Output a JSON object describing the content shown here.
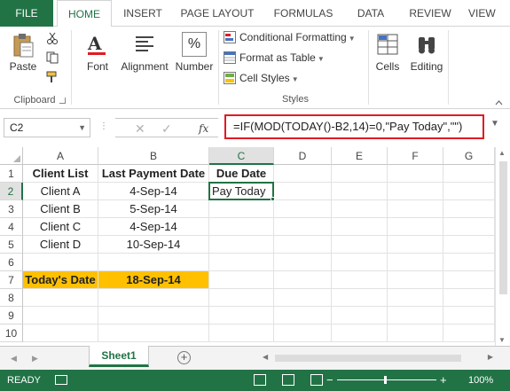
{
  "ribbon_tabs": {
    "file": "FILE",
    "home": "HOME",
    "insert": "INSERT",
    "page_layout": "PAGE LAYOUT",
    "formulas": "FORMULAS",
    "data": "DATA",
    "review": "REVIEW",
    "view": "VIEW"
  },
  "clipboard": {
    "paste_label": "Paste",
    "group_label": "Clipboard"
  },
  "font_group": {
    "label": "Font"
  },
  "alignment_group": {
    "label": "Alignment"
  },
  "number_group": {
    "label": "Number",
    "icon_text": "%"
  },
  "styles": {
    "conditional_formatting": "Conditional Formatting",
    "format_as_table": "Format as Table",
    "cell_styles": "Cell Styles",
    "group_label": "Styles"
  },
  "cells_group": {
    "label": "Cells"
  },
  "editing_group": {
    "label": "Editing"
  },
  "formula_bar": {
    "name_box": "C2",
    "formula": "=IF(MOD(TODAY()-B2,14)=0,\"Pay Today\",\"\")",
    "cancel_glyph": "✕",
    "enter_glyph": "✓",
    "fx_label": "fx"
  },
  "columns": [
    "A",
    "B",
    "C",
    "D",
    "E",
    "F",
    "G"
  ],
  "rows": [
    "1",
    "2",
    "3",
    "4",
    "5",
    "6",
    "7",
    "8",
    "9",
    "10"
  ],
  "cells": {
    "A1": "Client List",
    "B1": "Last Payment Date",
    "C1": "Due Date",
    "A2": "Client A",
    "B2": "4-Sep-14",
    "C2": "Pay Today",
    "A3": "Client B",
    "B3": "5-Sep-14",
    "A4": "Client C",
    "B4": "4-Sep-14",
    "A5": "Client D",
    "B5": "10-Sep-14",
    "A7": "Today's Date",
    "B7": "18-Sep-14"
  },
  "colors": {
    "excel_green": "#217346",
    "highlight": "#ffc000",
    "formula_outline": "#e01b24"
  },
  "sheet_tabs": {
    "active": "Sheet1",
    "add_glyph": "+"
  },
  "status_bar": {
    "ready": "READY",
    "zoom_minus": "−",
    "zoom_plus": "+",
    "zoom": "100%"
  }
}
